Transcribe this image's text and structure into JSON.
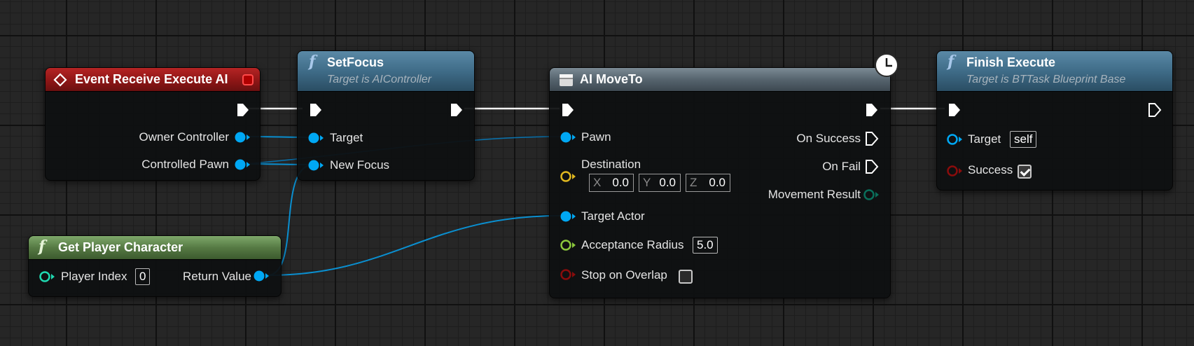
{
  "colors": {
    "exec": "#ffffff",
    "object_pin": "#00a8f4",
    "vector_pin": "#e0b820",
    "float_pin": "#8cc83c",
    "bool_pin": "#8a0c0c",
    "int_pin": "#1fd8b0",
    "enum_pin": "#0a6e5a",
    "event_header": "#8e1616",
    "function_header": "#3f6c88",
    "pure_header": "#4a7a3c",
    "latent_header": "#5e6e7a"
  },
  "nodes": {
    "event_receive": {
      "title": "Event Receive Execute AI",
      "icon": "event-diamond-icon",
      "delegate_icon": "delegate-square-icon",
      "pins": {
        "owner_controller": "Owner Controller",
        "controlled_pawn": "Controlled Pawn"
      }
    },
    "set_focus": {
      "icon": "function-icon",
      "title": "SetFocus",
      "subtitle": "Target is AIController",
      "pins": {
        "target": "Target",
        "new_focus": "New Focus"
      }
    },
    "ai_moveto": {
      "icon": "latent-node-icon",
      "clock_icon": "clock-icon",
      "title": "AI MoveTo",
      "pins": {
        "pawn": "Pawn",
        "destination": "Destination",
        "target_actor": "Target Actor",
        "acceptance_radius": "Acceptance Radius",
        "stop_on_overlap": "Stop on Overlap",
        "on_success": "On Success",
        "on_fail": "On Fail",
        "movement_result": "Movement Result"
      },
      "destination": {
        "x_label": "X",
        "x": "0.0",
        "y_label": "Y",
        "y": "0.0",
        "z_label": "Z",
        "z": "0.0"
      },
      "acceptance_radius_value": "5.0",
      "stop_on_overlap_checked": false
    },
    "finish_execute": {
      "icon": "function-icon",
      "title": "Finish Execute",
      "subtitle": "Target is BTTask Blueprint Base",
      "pins": {
        "target": "Target",
        "success": "Success"
      },
      "target_value": "self",
      "success_checked": true
    },
    "get_player_character": {
      "icon": "function-icon",
      "title": "Get Player Character",
      "pins": {
        "player_index": "Player Index",
        "return_value": "Return Value"
      },
      "player_index_value": "0"
    }
  }
}
